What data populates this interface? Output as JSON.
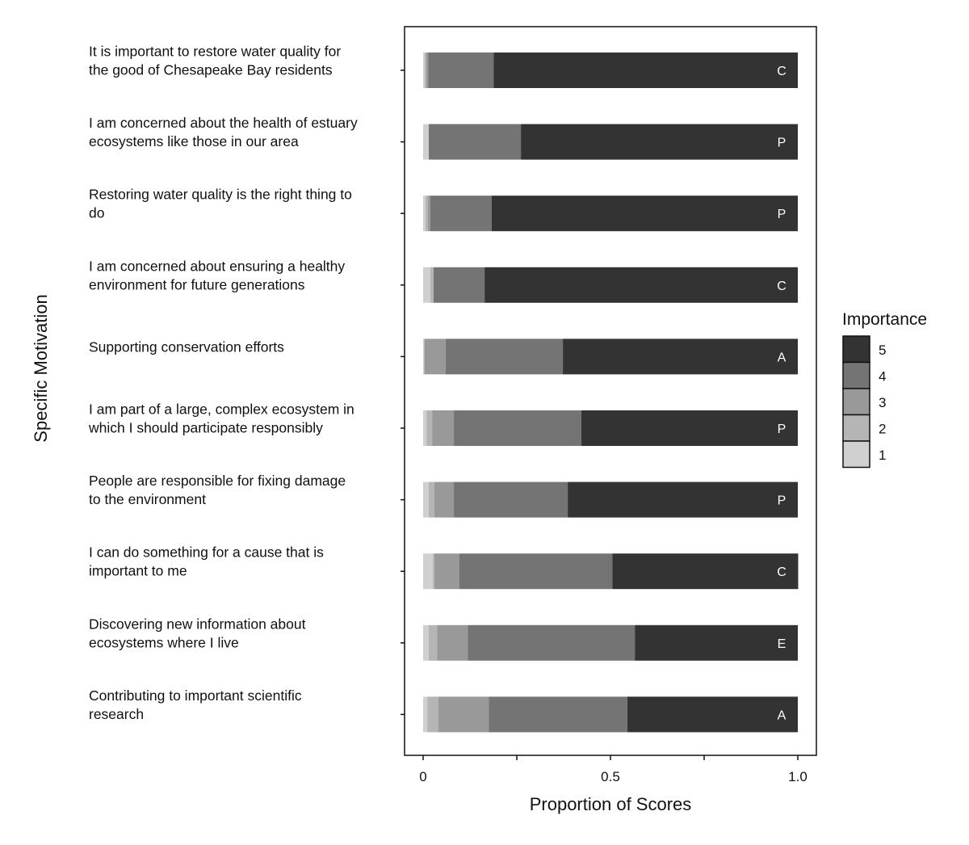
{
  "chart_data": {
    "type": "bar",
    "orientation": "horizontal",
    "stacked": true,
    "xlabel": "Proportion of Scores",
    "ylabel": "Specific Motivation",
    "xlim": [
      0,
      1.0
    ],
    "xticks": [
      0,
      0.25,
      0.5,
      0.75,
      1.0
    ],
    "xtick_labels": [
      "0",
      "",
      "0.5",
      "",
      "1.0"
    ],
    "grid": false,
    "legend": {
      "title": "Importance",
      "placement": "right",
      "entries": [
        {
          "label": "5",
          "color": "#333333"
        },
        {
          "label": "4",
          "color": "#747474"
        },
        {
          "label": "3",
          "color": "#999999"
        },
        {
          "label": "2",
          "color": "#b5b5b5"
        },
        {
          "label": "1",
          "color": "#d0d0d0"
        }
      ]
    },
    "categories": [
      {
        "lines": [
          "It is important to restore water quality for",
          "the good of Chesapeake Bay residents"
        ],
        "tag": "C"
      },
      {
        "lines": [
          "I am concerned about the health of estuary",
          "ecosystems like those in our area"
        ],
        "tag": "P"
      },
      {
        "lines": [
          "Restoring water quality is the right thing to",
          "do"
        ],
        "tag": "P"
      },
      {
        "lines": [
          "I am concerned about ensuring a healthy",
          "environment for future generations"
        ],
        "tag": "C"
      },
      {
        "lines": [
          "Supporting conservation efforts"
        ],
        "tag": "A"
      },
      {
        "lines": [
          "I am part of a large, complex ecosystem in",
          "which I should participate responsibly"
        ],
        "tag": "P"
      },
      {
        "lines": [
          "People are responsible for fixing damage",
          "to the environment"
        ],
        "tag": "P"
      },
      {
        "lines": [
          "I can do something for a cause that is",
          "important to me"
        ],
        "tag": "C"
      },
      {
        "lines": [
          "Discovering new information about",
          "ecosystems where I live"
        ],
        "tag": "E"
      },
      {
        "lines": [
          "Contributing to important scientific",
          "research"
        ],
        "tag": "A"
      }
    ],
    "series": [
      {
        "name": "1",
        "color": "#d0d0d0",
        "values": [
          0.004,
          0.015,
          0.006,
          0.019,
          0.002,
          0.009,
          0.015,
          0.026,
          0.015,
          0.011
        ]
      },
      {
        "name": "2",
        "color": "#b5b5b5",
        "values": [
          0.004,
          0.0,
          0.007,
          0.009,
          0.002,
          0.015,
          0.015,
          0.004,
          0.022,
          0.03
        ]
      },
      {
        "name": "3",
        "color": "#999999",
        "values": [
          0.006,
          0.0,
          0.006,
          0.0,
          0.056,
          0.058,
          0.052,
          0.067,
          0.082,
          0.134
        ]
      },
      {
        "name": "4",
        "color": "#747474",
        "values": [
          0.174,
          0.246,
          0.164,
          0.136,
          0.313,
          0.34,
          0.304,
          0.408,
          0.446,
          0.37
        ]
      },
      {
        "name": "5",
        "color": "#333333",
        "values": [
          0.812,
          0.739,
          0.817,
          0.836,
          0.627,
          0.578,
          0.614,
          0.496,
          0.435,
          0.455
        ]
      }
    ]
  }
}
